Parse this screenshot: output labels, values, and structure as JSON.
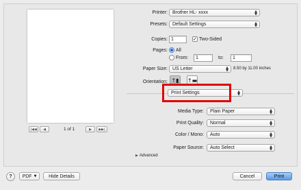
{
  "preview": {
    "first_page": "|◀◀",
    "prev_page": "◀",
    "page_count": "1 of 1",
    "next_page": "▶",
    "last_page": "▶▶|"
  },
  "printer": {
    "label": "Printer:",
    "value": "Brother HL- xxxx"
  },
  "presets": {
    "label": "Presets:",
    "value": "Default Settings"
  },
  "copies": {
    "label": "Copies:",
    "value": "1",
    "two_sided_label": "Two-Sided",
    "two_sided_checked": true
  },
  "pages": {
    "label": "Pages:",
    "all_label": "All",
    "from_label": "From:",
    "from_value": "1",
    "to_label": "to:",
    "to_value": "1",
    "selected": "All"
  },
  "paper_size": {
    "label": "Paper Size:",
    "value": "US Letter",
    "dimensions": "8.50 by 11.00 inches"
  },
  "orientation": {
    "label": "Orientation:",
    "selected": "portrait"
  },
  "section_popup": {
    "value": "Print Settings"
  },
  "media_type": {
    "label": "Media Type:",
    "value": "Plain Paper"
  },
  "print_quality": {
    "label": "Print Quality:",
    "value": "Normal"
  },
  "color_mono": {
    "label": "Color / Mono:",
    "value": "Auto"
  },
  "paper_source": {
    "label": "Paper Source:",
    "value": "Auto Select"
  },
  "advanced": {
    "label": "Advanced"
  },
  "footer": {
    "help": "?",
    "pdf_label": "PDF",
    "hide_details_label": "Hide Details",
    "cancel_label": "Cancel",
    "print_label": "Print"
  },
  "colors": {
    "highlight": "#e00000",
    "default_button": "#5b9be6"
  }
}
